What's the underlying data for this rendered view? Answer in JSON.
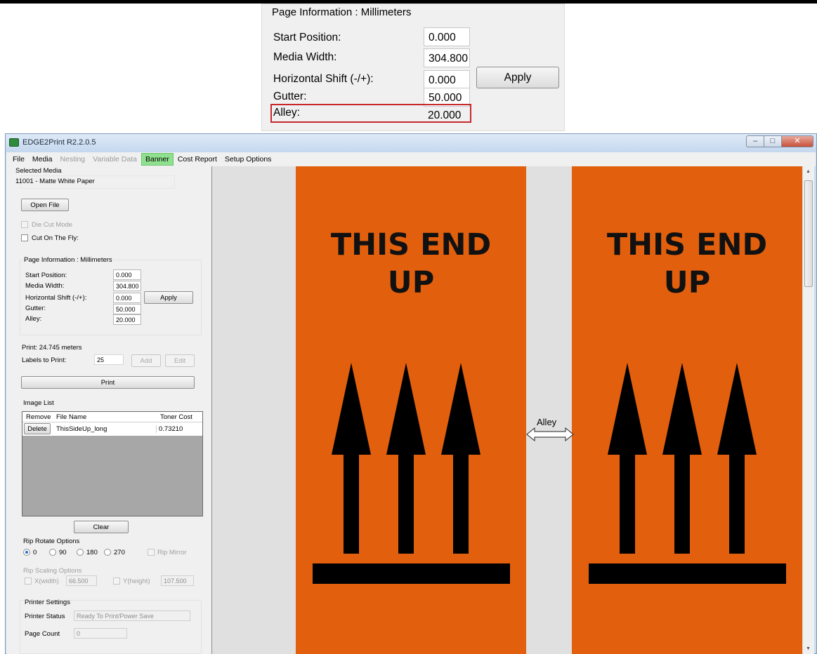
{
  "inset": {
    "title": "Page Information : Millimeters",
    "fields": [
      {
        "label": "Start Position:",
        "value": "0.000"
      },
      {
        "label": "Media Width:",
        "value": "304.800"
      },
      {
        "label": "Horizontal Shift (-/+):",
        "value": "0.000"
      },
      {
        "label": "Gutter:",
        "value": "50.000"
      },
      {
        "label": "Alley:",
        "value": "20.000"
      }
    ],
    "apply_label": "Apply",
    "highlight_color": "#c8282c"
  },
  "window": {
    "title": "EDGE2Print R2.2.0.5"
  },
  "menu": {
    "items": [
      {
        "label": "File",
        "state": "normal"
      },
      {
        "label": "Media",
        "state": "normal"
      },
      {
        "label": "Nesting",
        "state": "disabled"
      },
      {
        "label": "Variable Data",
        "state": "disabled"
      },
      {
        "label": "Banner",
        "state": "active"
      },
      {
        "label": "Cost Report",
        "state": "normal"
      },
      {
        "label": "Setup Options",
        "state": "normal"
      }
    ]
  },
  "left": {
    "selected_media_label": "Selected Media",
    "selected_media_value": "11001 - Matte White Paper",
    "open_file": "Open File",
    "die_cut_mode": "Die Cut Mode",
    "cut_on_the_fly": "Cut On The Fly:",
    "page_info": {
      "title": "Page Information : Millimeters",
      "start_position_label": "Start Position:",
      "start_position": "0.000",
      "media_width_label": "Media Width:",
      "media_width": "304.800",
      "horizontal_shift_label": "Horizontal Shift (-/+):",
      "horizontal_shift": "0.000",
      "gutter_label": "Gutter:",
      "gutter": "50.000",
      "alley_label": "Alley:",
      "alley": "20.000",
      "apply": "Apply"
    },
    "print_length": "Print: 24.745 meters",
    "labels_to_print_label": "Labels to Print:",
    "labels_to_print": "25",
    "add": "Add",
    "edit": "Edit",
    "print": "Print",
    "image_list": {
      "title": "Image List",
      "headers": [
        "Remove",
        "File Name",
        "Toner Cost"
      ],
      "rows": [
        {
          "action": "Delete",
          "file": "ThisSideUp_long",
          "cost": "0.73210"
        }
      ]
    },
    "clear": "Clear",
    "rip_rotate": {
      "title": "Rip Rotate Options",
      "options": [
        "0",
        "90",
        "180",
        "270"
      ],
      "selected": "0",
      "mirror": "Rip Mirror"
    },
    "rip_scaling": {
      "title": "Rip Scaling Options",
      "x_label": "X(width)",
      "x_value": "66.500",
      "y_label": "Y(height)",
      "y_value": "107.500"
    },
    "printer": {
      "title": "Printer Settings",
      "status_label": "Printer Status",
      "status_value": "Ready To Print/Power Save",
      "count_label": "Page Count",
      "count_value": "0"
    }
  },
  "canvas": {
    "label_text_line1": "THIS END",
    "label_text_line2": "UP",
    "alley_annotation": "Alley",
    "label_color": "#e2600d",
    "background": "#e0e0e0"
  }
}
